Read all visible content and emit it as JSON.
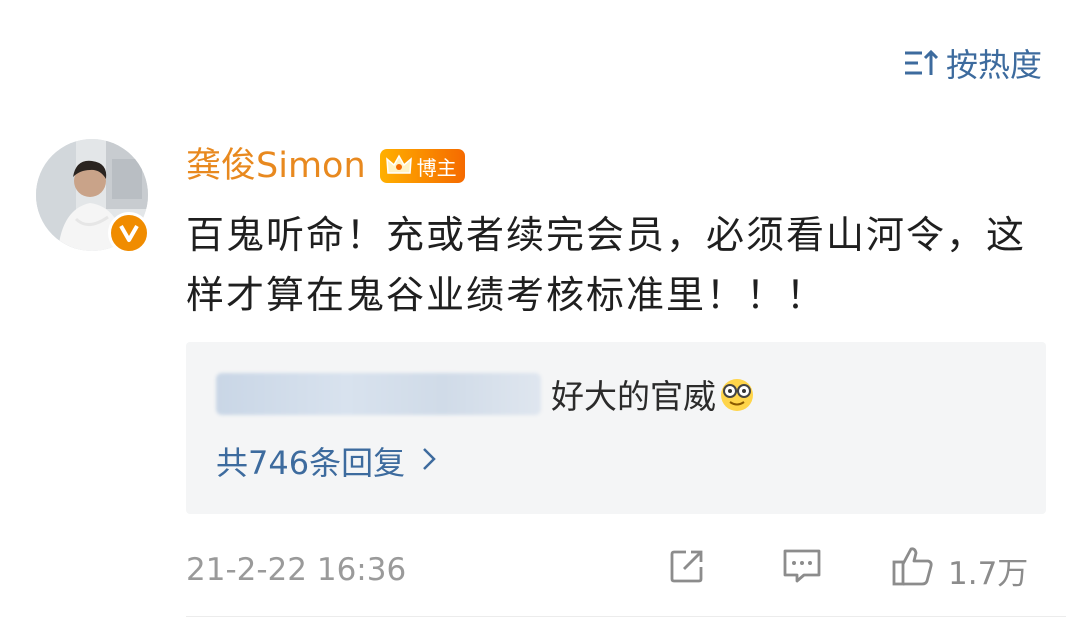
{
  "sort": {
    "label": "按热度",
    "icon": "sort-icon"
  },
  "comment": {
    "author": "龚俊Simon",
    "badge": "博主",
    "text": "百鬼听命！充或者续完会员，必须看山河令，这样才算在鬼谷业绩考核标准里！！！",
    "timestamp": "21-2-22 16:36",
    "like_count": "1.7万"
  },
  "reply": {
    "text": "好大的官威",
    "emoji": "glasses-smile-emoji",
    "count_label": "共746条回复"
  },
  "colors": {
    "link": "#3d6b9e",
    "author": "#e8891f",
    "muted": "#9a9a9a",
    "reply_bg": "#f4f5f6",
    "badge": "#f08c00"
  }
}
